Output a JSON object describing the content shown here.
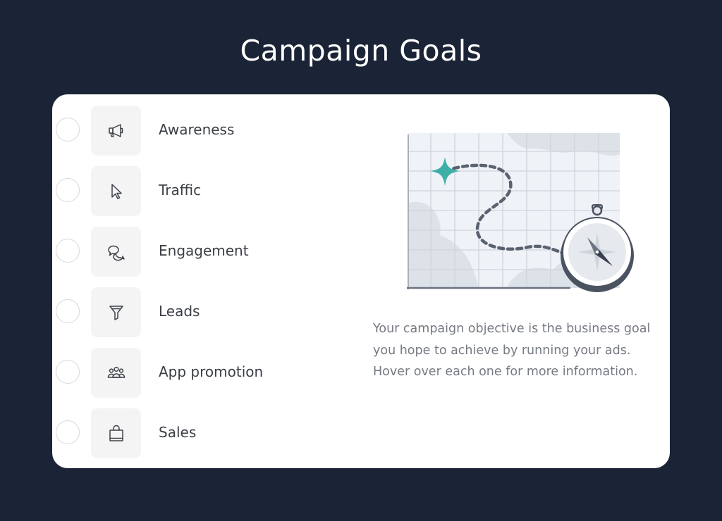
{
  "page": {
    "title": "Campaign Goals"
  },
  "colors": {
    "background": "#1b2336",
    "card": "#ffffff",
    "icon_tile": "#f4f4f5",
    "accent_star": "#3dafa7",
    "text": "#3b3f46",
    "muted_text": "#757a83"
  },
  "objectives": [
    {
      "label": "Awareness",
      "icon": "megaphone-icon",
      "selected": false
    },
    {
      "label": "Traffic",
      "icon": "cursor-icon",
      "selected": false
    },
    {
      "label": "Engagement",
      "icon": "chat-bubbles-icon",
      "selected": false
    },
    {
      "label": "Leads",
      "icon": "funnel-icon",
      "selected": false
    },
    {
      "label": "App promotion",
      "icon": "people-icon",
      "selected": false
    },
    {
      "label": "Sales",
      "icon": "shopping-bag-icon",
      "selected": false
    }
  ],
  "info_panel": {
    "illustration": "map-with-compass",
    "description": "Your campaign objective is the business goal you hope to achieve by running your ads. Hover over each one for more information."
  }
}
